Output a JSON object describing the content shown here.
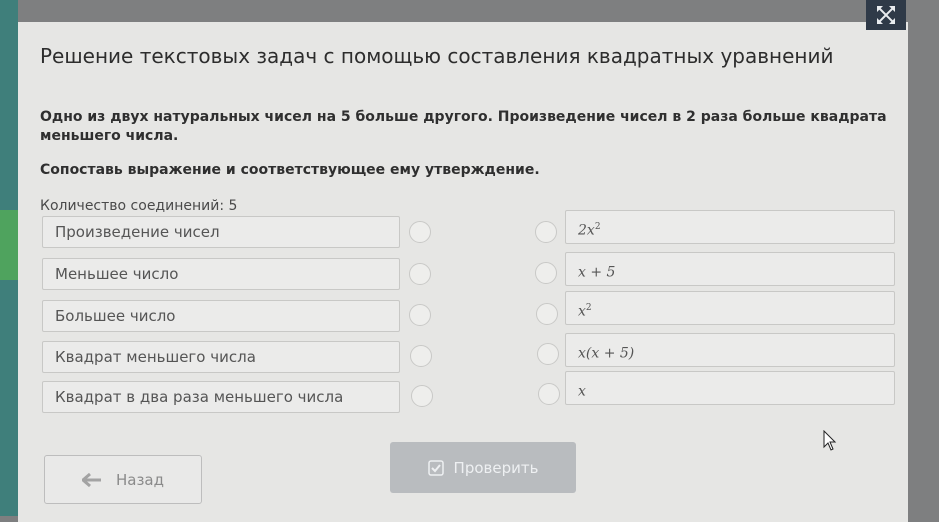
{
  "title": "Решение текстовых задач с помощью составления квадратных уравнений",
  "task": "Одно из двух натуральных чисел на 5 больше другого. Произведение чисел в 2 раза больше квадрата меньшего числа.",
  "instruction": "Сопоставь выражение и соответствующее ему утверждение.",
  "connections_label": "Количество соединений: 5",
  "left_items": [
    "Произведение чисел",
    "Меньшее число",
    "Большее число",
    "Квадрат меньшего числа",
    "Квадрат в два раза меньшего числа"
  ],
  "right_items": [
    {
      "base": "2x",
      "sup": "2"
    },
    {
      "base": "x + 5",
      "sup": ""
    },
    {
      "base": "x",
      "sup": "2"
    },
    {
      "base": "x(x + 5)",
      "sup": ""
    },
    {
      "base": "x",
      "sup": ""
    }
  ],
  "buttons": {
    "back": "Назад",
    "check": "Проверить"
  },
  "icons": {
    "expand": "expand-icon",
    "back": "arrow-left-icon",
    "check": "check-icon",
    "cursor": "mouse-cursor-icon"
  }
}
